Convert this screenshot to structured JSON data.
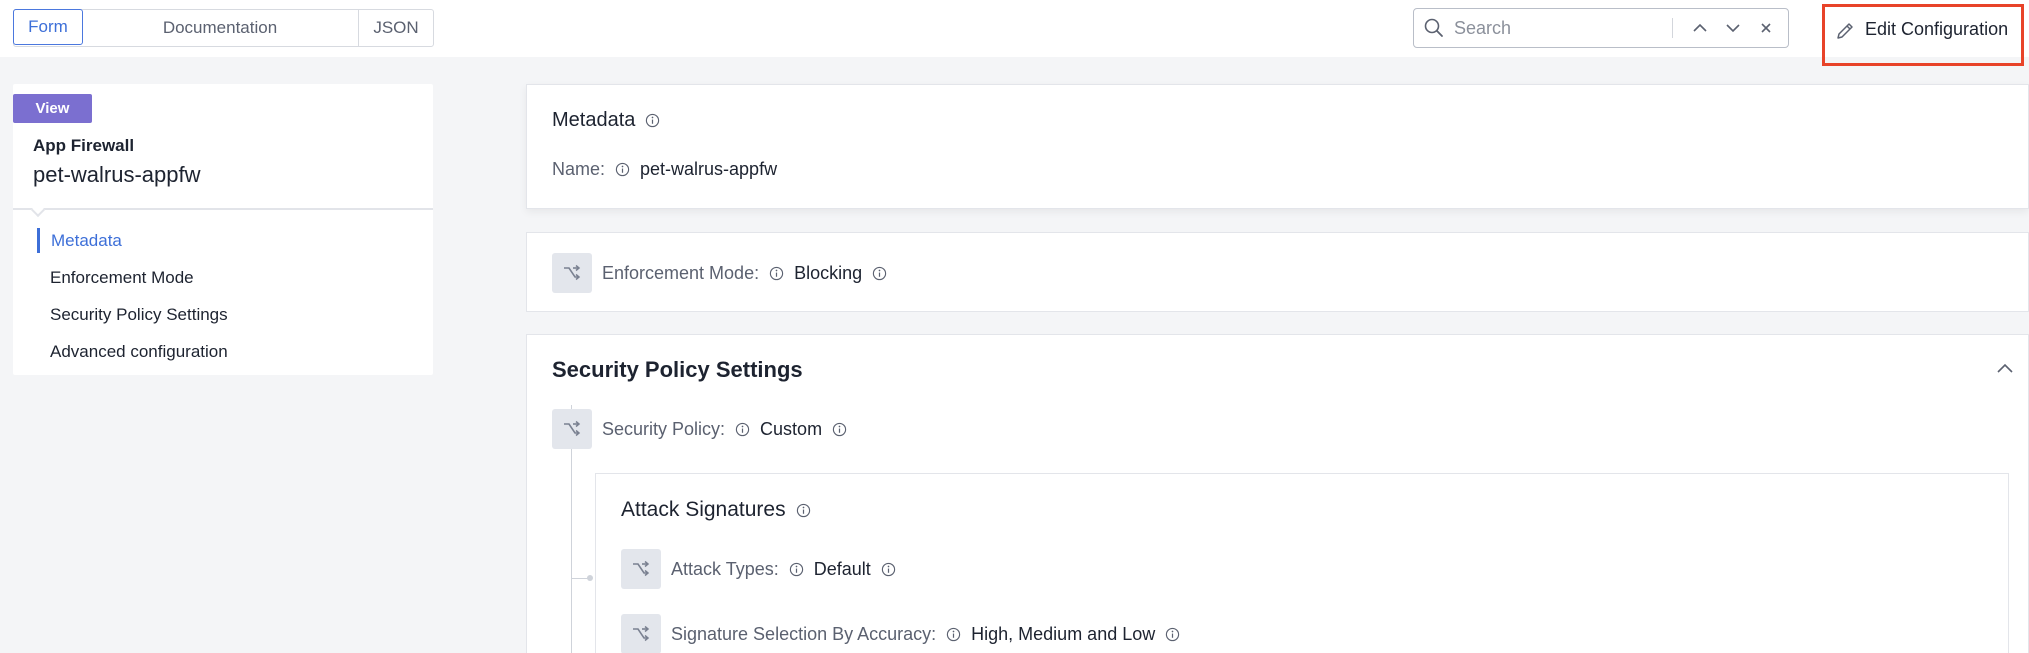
{
  "tabs": [
    {
      "label": "Form",
      "active": true
    },
    {
      "label": "Documentation",
      "active": false
    },
    {
      "label": "JSON",
      "active": false
    }
  ],
  "search": {
    "placeholder": "Search"
  },
  "edit_button": {
    "label": "Edit Configuration"
  },
  "sidebar": {
    "badge": "View",
    "object_type": "App Firewall",
    "object_name": "pet-walrus-appfw",
    "items": [
      {
        "label": "Metadata",
        "active": true
      },
      {
        "label": "Enforcement Mode",
        "active": false
      },
      {
        "label": "Security Policy Settings",
        "active": false
      },
      {
        "label": "Advanced configuration",
        "active": false
      }
    ]
  },
  "metadata": {
    "title": "Metadata",
    "name_label": "Name:",
    "name_value": "pet-walrus-appfw"
  },
  "enforcement": {
    "label": "Enforcement Mode:",
    "value": "Blocking"
  },
  "security": {
    "title": "Security Policy Settings",
    "policy_label": "Security Policy:",
    "policy_value": "Custom",
    "attack_signatures": {
      "title": "Attack Signatures",
      "attack_types_label": "Attack Types:",
      "attack_types_value": "Default",
      "accuracy_label": "Signature Selection By Accuracy:",
      "accuracy_value": "High, Medium and Low"
    }
  },
  "colors": {
    "accent": "#3d6fd8",
    "badge": "#7b6fd0",
    "highlight_border": "#e84329"
  }
}
